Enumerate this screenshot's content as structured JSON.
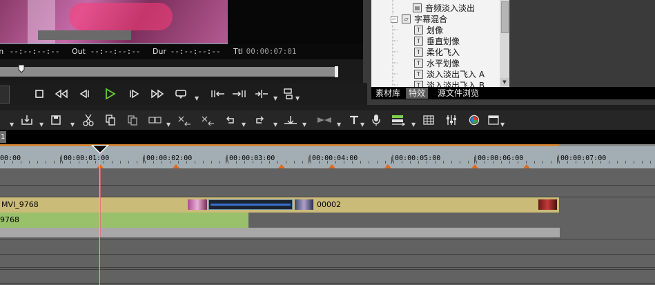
{
  "preview": {
    "in_label": "In",
    "in_value": " --:--:--:--",
    "out_label": "Out",
    "out_value": " --:--:--:--",
    "dur_label": "Dur",
    "dur_value": " --:--:--:--",
    "ttl_label": "Ttl",
    "ttl_value": " 00:00:07:01"
  },
  "transport": {
    "buttons": [
      "stop-icon",
      "rewind-icon",
      "step-back-icon",
      "play-icon",
      "step-forward-icon",
      "fast-forward-icon",
      "loop-icon"
    ]
  },
  "effects_tree": {
    "items": [
      {
        "label": "音频淡入淡出",
        "icon": "folder-icon"
      },
      {
        "label": "字幕混合",
        "icon": "folder-open-icon"
      },
      {
        "label": "划像",
        "icon": "title-effect-icon"
      },
      {
        "label": "垂直划像",
        "icon": "title-effect-icon"
      },
      {
        "label": "柔化飞入",
        "icon": "title-effect-icon"
      },
      {
        "label": "水平划像",
        "icon": "title-effect-icon"
      },
      {
        "label": "淡入淡出飞入 A",
        "icon": "title-effect-icon"
      },
      {
        "label": "淡入淡出飞入 B",
        "icon": "title-effect-icon"
      }
    ]
  },
  "tabs": [
    "素材库",
    "特效",
    "源文件浏览"
  ],
  "timeline": {
    "track_number": "1",
    "ruler_labels": [
      "00:00",
      "|00:00:01:00",
      "|00:00:02:00",
      "|00:00:03:00",
      "|00:00:04:00",
      "|00:00:05:00",
      "|00:00:06:00",
      "|00:00:07:00"
    ],
    "video_clip_label": "MVI_9768",
    "video_clip2_label": "00002",
    "audio_clip_label": "9768"
  },
  "colors": {
    "play": "#6ccd3a",
    "ruler_marker": "#e06a1f",
    "video_clip": "#cbbb78",
    "audio_clip": "#99c06a",
    "playhead": "#7fd6e0"
  }
}
